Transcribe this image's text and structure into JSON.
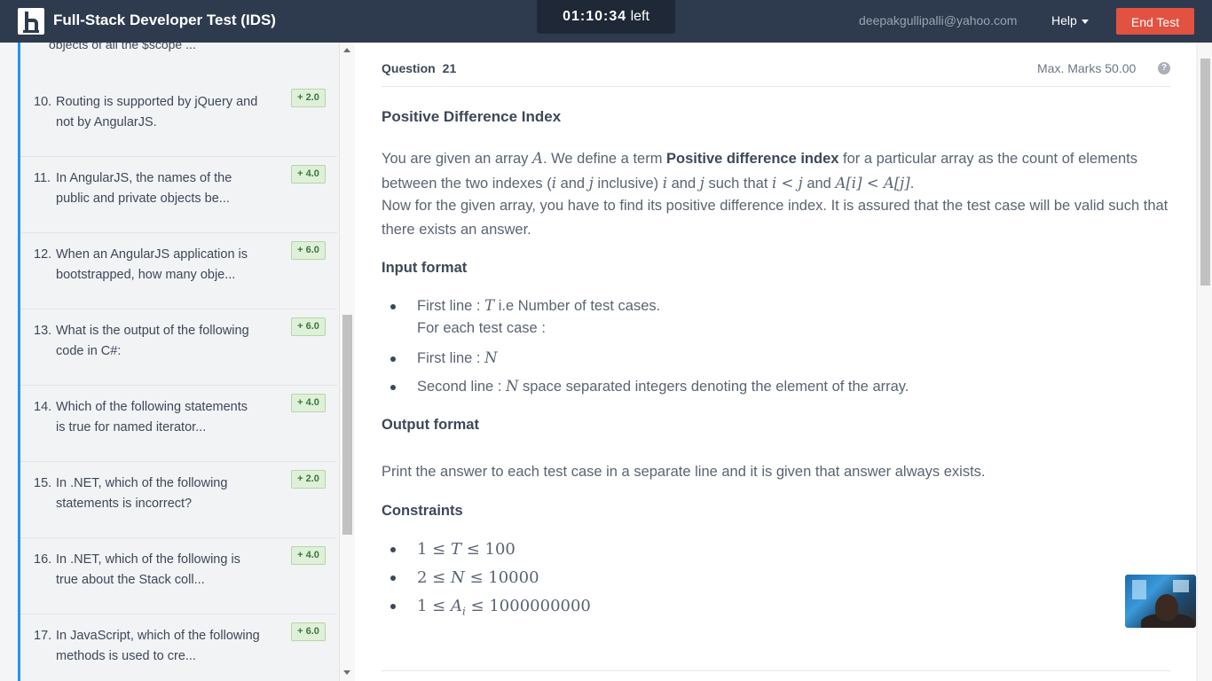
{
  "header": {
    "title": "Full-Stack Developer Test (IDS)",
    "timer_value": "01:10:34",
    "timer_suffix": "left",
    "email": "deepakgullipalli@yahoo.com",
    "help_label": "Help",
    "end_button_label": "End Test"
  },
  "sidebar": {
    "partial_item_text": "objects of all the $scope ...",
    "items": [
      {
        "num": "10.",
        "text": "Routing is supported by jQuery and not by AngularJS.",
        "marks": "+ 2.0"
      },
      {
        "num": "11.",
        "text": "In AngularJS, the names of the public and private objects be...",
        "marks": "+ 4.0"
      },
      {
        "num": "12.",
        "text": "When an AngularJS application is bootstrapped, how many obje...",
        "marks": "+ 6.0"
      },
      {
        "num": "13.",
        "text": "What is the output of the following code in C#:",
        "marks": "+ 6.0"
      },
      {
        "num": "14.",
        "text": "Which of the following statements is true for named iterator...",
        "marks": "+ 4.0"
      },
      {
        "num": "15.",
        "text": "In .NET, which of the following statements is incorrect?",
        "marks": "+ 2.0"
      },
      {
        "num": "16.",
        "text": "In .NET, which of the following is true about the Stack coll...",
        "marks": "+ 4.0"
      },
      {
        "num": "17.",
        "text": "In JavaScript, which of the following methods is used to cre...",
        "marks": "+ 6.0"
      }
    ]
  },
  "question": {
    "label": "Question",
    "number": "21",
    "max_marks": "Max. Marks 50.00",
    "help_icon": "?",
    "title": "Positive Difference Index",
    "p1": {
      "t1": "You are given an array ",
      "m1": "A",
      "t2": ". We define a term ",
      "bold": "Positive difference index",
      "t3": " for a particular array as the count of elements between the two indexes (",
      "m2": "i",
      "t4": " and ",
      "m3": "j",
      "t5": " inclusive) ",
      "m4": "i",
      "t6": " and ",
      "m5": "j",
      "t7": " such that ",
      "m6": "i < j",
      "t8": " and ",
      "m7": "A[i] < A[j]",
      "t9": "."
    },
    "p2": "Now for the given array, you have to find its positive difference index. It is assured that the test case will be valid such that there exists an answer.",
    "input_title": "Input format",
    "input": {
      "b1_pre": "First line : ",
      "b1_math": "T",
      "b1_post": " i.e Number of test cases.",
      "sub": "For each test case :",
      "b2_pre": "First line : ",
      "b2_math": "N",
      "b3_pre": "Second line : ",
      "b3_math": "N",
      "b3_post": " space separated integers denoting the element of the array."
    },
    "output_title": "Output format",
    "output_text": "Print the answer to each test case in a separate line and it is given that answer always exists.",
    "constraints_title": "Constraints",
    "constraints": [
      {
        "lo": "1 ≤ ",
        "var": "T",
        "sub": "",
        "hi": " ≤ 100"
      },
      {
        "lo": "2 ≤ ",
        "var": "N",
        "sub": "",
        "hi": " ≤ 10000"
      },
      {
        "lo": "1 ≤ ",
        "var": "A",
        "sub": "i",
        "hi": " ≤ 1000000000"
      }
    ]
  }
}
